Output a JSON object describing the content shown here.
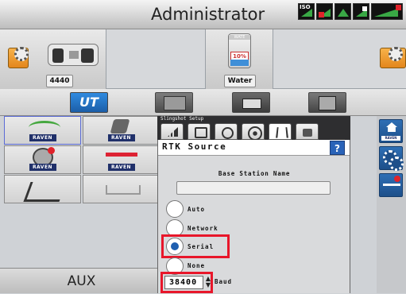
{
  "header": {
    "title": "Administrator",
    "status_icons": [
      "iso-status-icon",
      "alarm-icon",
      "gps-status-icon",
      "sprayer-status-icon",
      "flag-icon"
    ],
    "iso_label": "ISO"
  },
  "equipment": {
    "vehicle_label": "4440",
    "product_label": "Water",
    "tank_level_percent": 10,
    "tank_percent_text": "10%",
    "tank_caption": "WATE"
  },
  "tabs": [
    {
      "name": "ut-tab",
      "label": "UT",
      "active": true
    },
    {
      "name": "field-map-tab",
      "label": "",
      "active": false
    },
    {
      "name": "camera-tab",
      "label": "",
      "active": false
    },
    {
      "name": "video-tab",
      "label": "",
      "active": false
    }
  ],
  "left_apps": {
    "brand_label": "RAVEN",
    "items": [
      "raven-guidance-app",
      "raven-rover-app",
      "raven-alarm-app",
      "raven-boom-app",
      "tilt-calibration-app",
      "boom-structure-app"
    ]
  },
  "aux": {
    "label": "AUX"
  },
  "dialog": {
    "caption": "Slingshot Setup",
    "title": "RTK Source",
    "help_label": "?",
    "base_station_label": "Base Station Name",
    "base_station_value": "",
    "options": [
      {
        "label": "Auto",
        "selected": false
      },
      {
        "label": "Network",
        "selected": false
      },
      {
        "label": "Serial",
        "selected": true
      },
      {
        "label": "None",
        "selected": false
      }
    ],
    "baud_value": "38400",
    "baud_unit": "Baud",
    "spinner_up": "▲",
    "spinner_down": "▼"
  },
  "colors": {
    "accent_blue": "#1f5fb0",
    "highlight_red": "#e8162a",
    "raven_navy": "#20306a"
  }
}
